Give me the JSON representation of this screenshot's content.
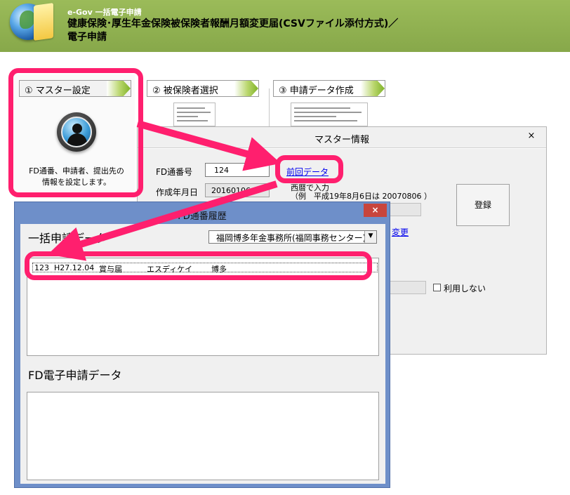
{
  "header": {
    "app_name": "e-Gov 一括電子申請",
    "form_title_line1": "健康保険･厚生年金保険被保険者報酬月額変更届(CSVファイル添付方式)／",
    "form_title_line2": "電子申請"
  },
  "steps": [
    {
      "label": "① マスター設定"
    },
    {
      "label": "② 被保険者選択"
    },
    {
      "label": "③ 申請データ作成"
    }
  ],
  "step1_description_line1": "FD通番、申請者、提出先の",
  "step1_description_line2": "情報を設定します。",
  "master_dialog": {
    "title": "マスター情報",
    "close": "×",
    "fd_no_label": "FD通番号",
    "fd_no_value": "124",
    "prev_data_link": "前回データ",
    "created_label": "作成年月日",
    "created_value": "20160106",
    "date_hint_line1": "西暦で入力",
    "date_hint_line2": "（例　平成19年8月6日は 20070806 ）",
    "register_button": "登録",
    "change_link": "変更",
    "unused_label": "利用しない"
  },
  "fd_window": {
    "title": "FD通番履歴",
    "close": "×",
    "batch_heading": "一括申請データ",
    "office_selected": "福岡博多年金事務所(福岡事務センター)",
    "batch_row": {
      "no": "123",
      "date": "H27.12.04",
      "type": "賞与届",
      "company": "エスディケイ",
      "office": "博多"
    },
    "fd_heading": "FD電子申請データ"
  },
  "colors": {
    "header_green": "#9bbb59",
    "highlight_pink": "#ff1f6e",
    "window_blue": "#6e8fc9",
    "close_red": "#c8453c"
  }
}
